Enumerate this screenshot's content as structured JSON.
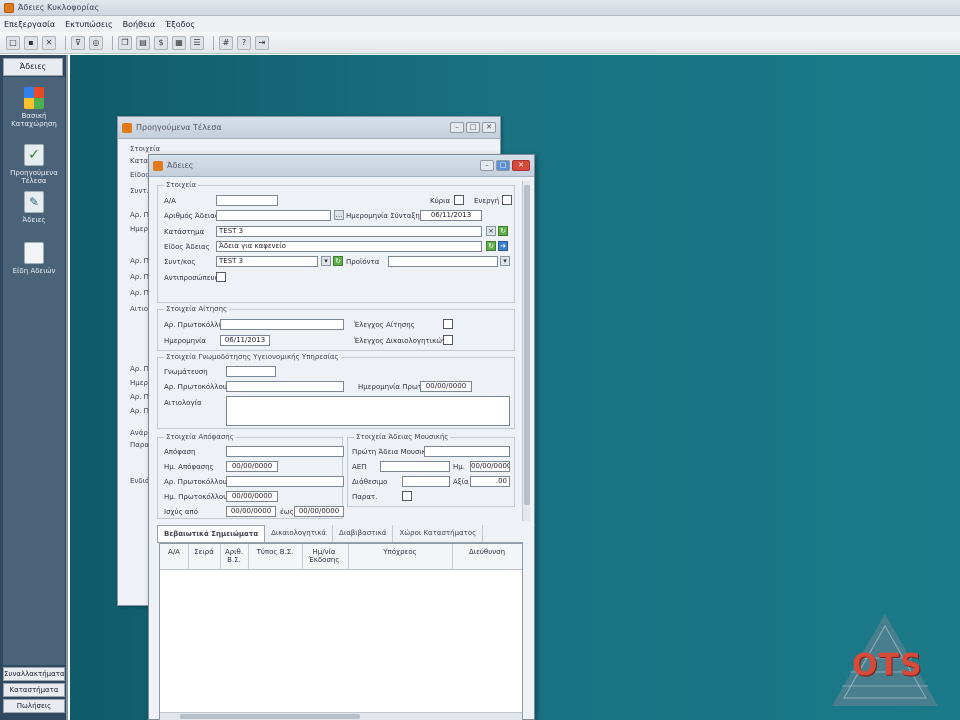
{
  "app": {
    "title": "Άδειες Κυκλοφορίας"
  },
  "menu": [
    "Επεξεργασία",
    "Εκτυπώσεις",
    "Βοήθεια",
    "Έξοδος"
  ],
  "sidebar": {
    "header": "Άδειες",
    "items": [
      {
        "label": "Βασική Καταχώρηση",
        "icon": "windows-logo-icon"
      },
      {
        "label": "Προηγούμενα Τέλεσα",
        "icon": "folder-check-icon"
      },
      {
        "label": "Άδειες",
        "icon": "document-pencil-icon"
      },
      {
        "label": "Είδη Αδειών",
        "icon": "document-icon"
      }
    ],
    "bottom": [
      "Συναλλακτήματα",
      "Καταστήματα",
      "Πωλήσεις"
    ]
  },
  "back_window": {
    "title": "Προηγούμενα Τέλεσα",
    "labels": [
      "Στοιχεία",
      "Καταστ.",
      "Είδος",
      "Συντ.",
      "Αρ. Π.",
      "Ημερ.",
      "Αρ. Π.",
      "Αρ. Π.",
      "Αρ. Π.",
      "Αιτιολ.",
      "Αρ. Π.",
      "Ημερ.",
      "Αρ. Π.",
      "Αρ. Π.",
      "Ανάρ.",
      "Παρατ.",
      "Ενδιάμεσα"
    ]
  },
  "front_window": {
    "title": "Άδειες",
    "group_details": {
      "title": "Στοιχεία",
      "aa_label": "Α/Α",
      "aa_value": "",
      "license_number_label": "Αριθμός Άδειας",
      "license_number_value": "",
      "creation_date_label": "Ημερομηνία Σύνταξης",
      "creation_date_value": "06/11/2013",
      "active_label": "Κύρια",
      "enabled_label": "Ενεργή",
      "store_label": "Κατάστημα",
      "store_value": "TEST 3",
      "license_type_label": "Είδος Άδειας",
      "license_type_value": "Άδεια για καφενείο",
      "partner_label": "Συντ/κος",
      "partner_value": "TEST 3",
      "previous_label": "Προϊόντα",
      "previous_value": "",
      "representation_label": "Αντιπροσώπευση"
    },
    "group_application": {
      "title": "Στοιχεία Αίτησης",
      "protocol_label": "Αρ. Πρωτοκόλλου",
      "protocol_value": "",
      "date_label": "Ημερομηνία",
      "date_value": "06/11/2013",
      "check_app_label": "Έλεγχος Αίτησης",
      "check_docs_label": "Έλεγχος Δικαιολογητικών"
    },
    "group_opinion": {
      "title": "Στοιχεία Γνωμοδότησης Υγειονομικής Υπηρεσίας",
      "opinion_label": "Γνωμάτευση",
      "opinion_value": "",
      "protocol_label": "Αρ. Πρωτοκόλλου",
      "protocol_value": "",
      "protocol_date_label": "Ημερομηνία Πρωτ.",
      "protocol_date_value": "00/00/0000",
      "reason_label": "Αιτιολογία",
      "reason_value": ""
    },
    "group_decision": {
      "title": "Στοιχεία Απόφασης",
      "decision_label": "Απόφαση",
      "decision_value": "",
      "decision_date_label": "Ημ. Απόφασης",
      "decision_date_value": "00/00/0000",
      "protocol_label": "Αρ. Πρωτοκόλλου",
      "protocol_value": "",
      "protocol_date_label": "Ημ. Πρωτοκόλλου",
      "protocol_date_value": "00/00/0000",
      "valid_from_label": "Ισχύς από",
      "valid_from_value": "00/00/0000",
      "valid_to_label": "έως",
      "valid_to_value": "00/00/0000"
    },
    "group_music": {
      "title": "Στοιχεία Άδειας Μουσικής",
      "first_license_label": "Πρώτη Άδεια Μουσικής",
      "first_license_value": "",
      "afm_label": "ΑΕΠ",
      "afm_value": "",
      "date_label": "Ημ.",
      "date_value": "00/00/0000",
      "duration_label": "Διάθεσιμο",
      "duration_value": "",
      "cost_label": "Αξία",
      "cost_value": ".00",
      "remarks_label": "Παρατ."
    },
    "tabs": [
      "Βεβαιωτικά Σημειώματα",
      "Δικαιολογητικά",
      "Διαβιβαστικά",
      "Χώροι Καταστήματος"
    ],
    "grid_headers": [
      "Α/Α",
      "Σειρά",
      "Αριθ. Β.Σ.",
      "Τύπος Β.Σ.",
      "Ημ/νία Έκδοσης",
      "Υπόχρεος",
      "Διεύθυνση"
    ]
  },
  "logo": {
    "text": "OTS"
  }
}
